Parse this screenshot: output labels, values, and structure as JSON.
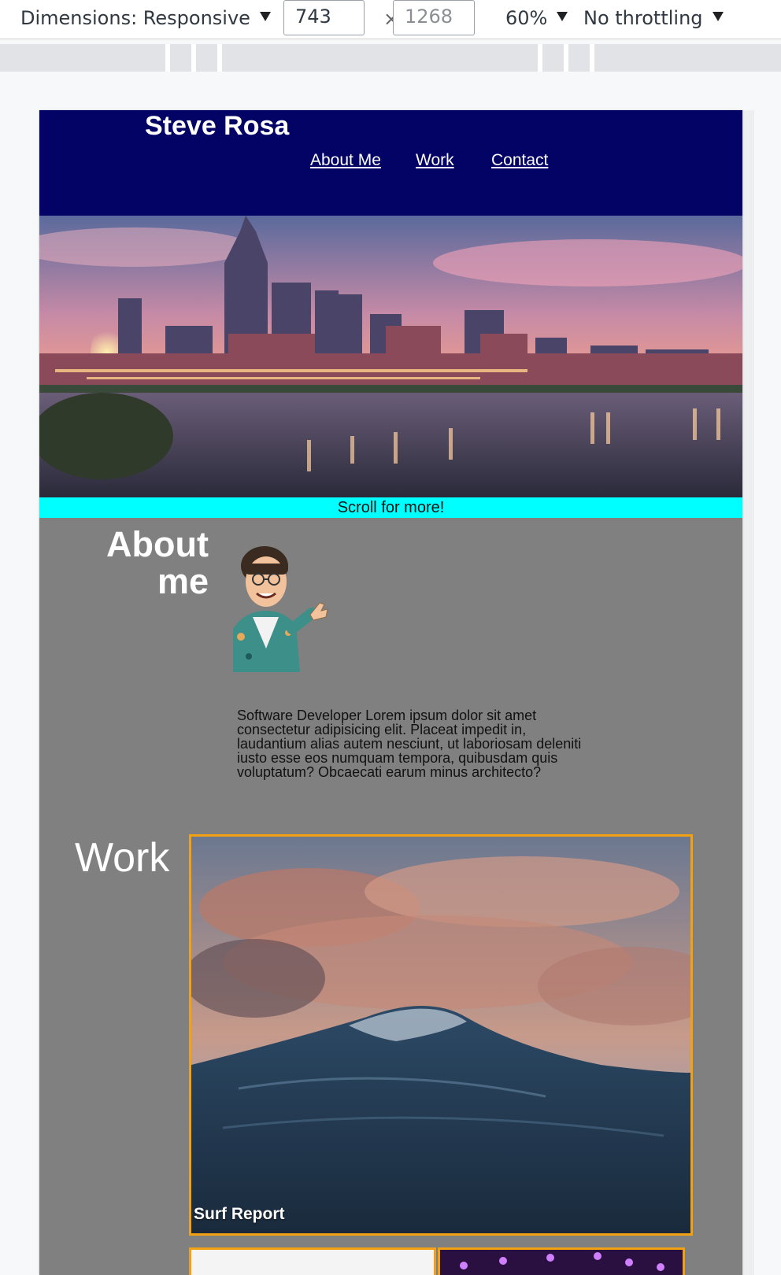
{
  "devtools": {
    "dimensions_label": "Dimensions: Responsive",
    "width_value": "743",
    "height_placeholder": "1268",
    "times_symbol": "×",
    "zoom": "60%",
    "throttling": "No throttling"
  },
  "site": {
    "title": "Steve Rosa",
    "nav": [
      {
        "label": "About Me"
      },
      {
        "label": "Work"
      },
      {
        "label": "Contact"
      }
    ],
    "scroll_banner": "Scroll for more!",
    "colors": {
      "header_bg": "#030366",
      "banner_bg": "#00ffff",
      "page_bg": "#808080",
      "card_border": "#f2a113"
    }
  },
  "about": {
    "heading": "About me",
    "body": "Software Developer Lorem ipsum dolor sit amet consectetur adipisicing elit. Placeat impedit in, laudantium alias autem nesciunt, ut laboriosam deleniti iusto esse eos numquam tempora, quibusdam quis voluptatum? Obcaecati earum minus architecto?"
  },
  "work": {
    "heading": "Work",
    "projects": [
      {
        "label": "Surf Report"
      }
    ]
  }
}
